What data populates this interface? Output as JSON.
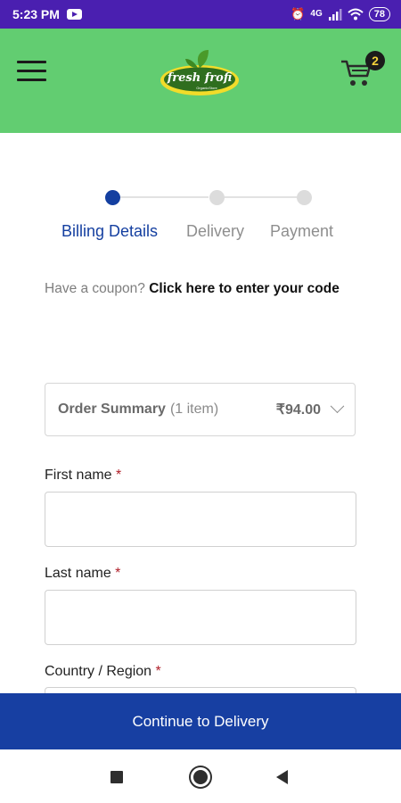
{
  "status_bar": {
    "time": "5:23 PM",
    "network": "4G",
    "battery": "78",
    "icons": [
      "youtube-icon",
      "alarm-icon",
      "network-icon",
      "signal-icon",
      "wifi-icon",
      "battery-icon"
    ]
  },
  "header": {
    "logo_text": "fresh frofi",
    "logo_subtext": "OrganicStore",
    "cart_count": "2",
    "colors": {
      "background": "#62cd71",
      "badge": "#1b1b1b",
      "badge_text": "#f4d23b"
    }
  },
  "stepper": {
    "steps": [
      {
        "label": "Billing Details",
        "active": true
      },
      {
        "label": "Delivery",
        "active": false
      },
      {
        "label": "Payment",
        "active": false
      }
    ],
    "active_color": "#143fa0"
  },
  "coupon": {
    "prompt": "Have a coupon?",
    "link": "Click here to enter your code"
  },
  "order_summary": {
    "title": "Order Summary",
    "count": "(1 item)",
    "price": "₹94.00"
  },
  "form": {
    "first_name_label": "First name",
    "last_name_label": "Last name",
    "country_label": "Country / Region",
    "required_marker": "*",
    "first_name_value": "",
    "last_name_value": ""
  },
  "cta": {
    "label": "Continue to Delivery",
    "color": "#173fa2"
  }
}
